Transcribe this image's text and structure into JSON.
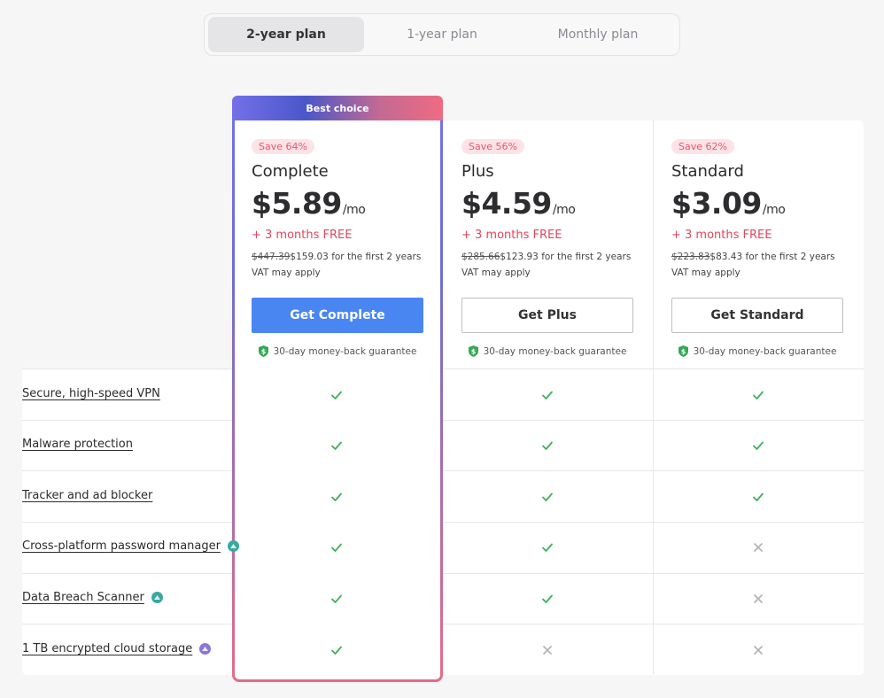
{
  "billing_tabs": [
    {
      "label": "2-year plan",
      "active": true
    },
    {
      "label": "1-year plan",
      "active": false
    },
    {
      "label": "Monthly plan",
      "active": false
    }
  ],
  "best_choice_label": "Best choice",
  "plans": [
    {
      "save": "Save 64%",
      "name": "Complete",
      "price": "$5.89",
      "per": "/mo",
      "bonus": "+ 3 months FREE",
      "original_price": "$447.39",
      "discounted_price": "$159.03",
      "period_text": "for the first 2 years",
      "vat": "VAT may apply",
      "cta": "Get Complete",
      "guarantee": "30-day money-back guarantee"
    },
    {
      "save": "Save 56%",
      "name": "Plus",
      "price": "$4.59",
      "per": "/mo",
      "bonus": "+ 3 months FREE",
      "original_price": "$285.66",
      "discounted_price": "$123.93",
      "period_text": "for the first 2 years",
      "vat": "VAT may apply",
      "cta": "Get Plus",
      "guarantee": "30-day money-back guarantee"
    },
    {
      "save": "Save 62%",
      "name": "Standard",
      "price": "$3.09",
      "per": "/mo",
      "bonus": "+ 3 months FREE",
      "original_price": "$223.83",
      "discounted_price": "$83.43",
      "period_text": "for the first 2 years",
      "vat": "VAT may apply",
      "cta": "Get Standard",
      "guarantee": "30-day money-back guarantee"
    }
  ],
  "features": [
    {
      "label": "Secure, high-speed VPN",
      "icon": "none",
      "included": [
        true,
        true,
        true
      ]
    },
    {
      "label": "Malware protection",
      "icon": "none",
      "included": [
        true,
        true,
        true
      ]
    },
    {
      "label": "Tracker and ad blocker",
      "icon": "none",
      "included": [
        true,
        true,
        true
      ]
    },
    {
      "label": "Cross-platform password manager",
      "icon": "teal-app-icon",
      "included": [
        true,
        true,
        false
      ]
    },
    {
      "label": "Data Breach Scanner",
      "icon": "teal-app-icon",
      "included": [
        true,
        true,
        false
      ]
    },
    {
      "label": "1 TB encrypted cloud storage",
      "icon": "purple-app-icon",
      "included": [
        true,
        false,
        false
      ]
    }
  ],
  "colors": {
    "accent_blue": "#4a86f1",
    "save_pink": "#e05a6f",
    "free_red": "#e0465c",
    "check_green": "#3fb05a",
    "cross_gray": "#b5b5b8",
    "teal_icon": "#3aa6a0",
    "purple_icon": "#8b76d8"
  }
}
